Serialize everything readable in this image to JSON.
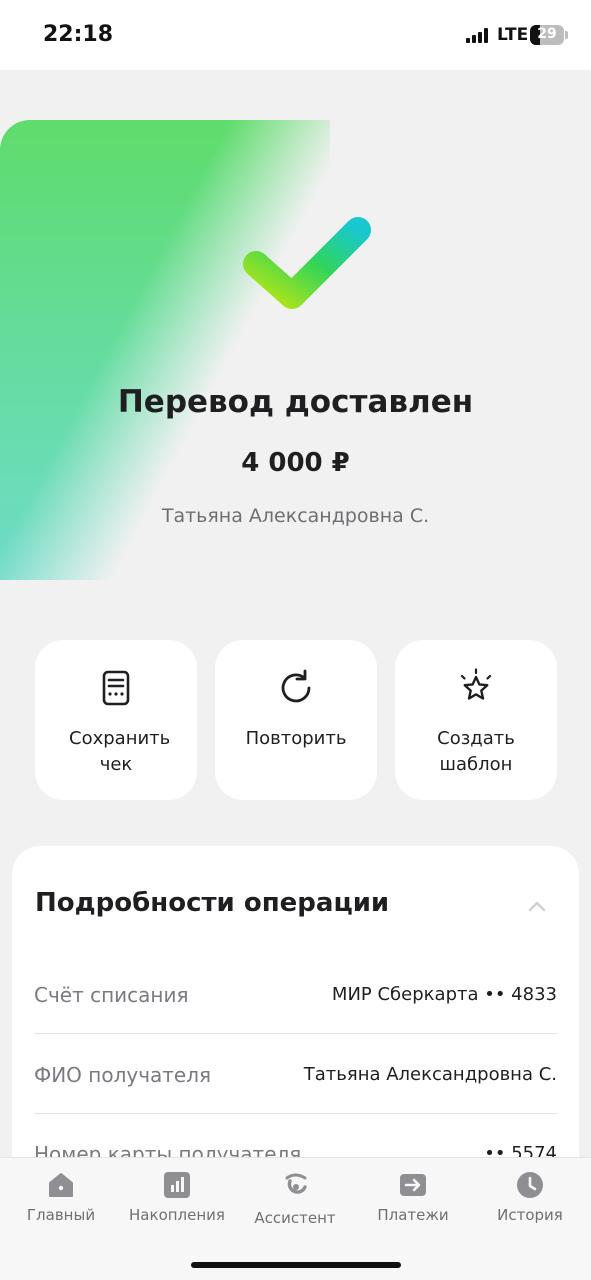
{
  "status": {
    "time": "22:18",
    "network": "LTE",
    "battery": "29",
    "battery_level": 0.29
  },
  "result": {
    "title": "Перевод доставлен",
    "amount": "4 000 ₽",
    "recipient": "Татьяна Александровна С.",
    "icon": "checkmark-icon"
  },
  "actions": [
    {
      "icon": "receipt-icon",
      "label": "Сохранить чек"
    },
    {
      "icon": "repeat-icon",
      "label": "Повторить"
    },
    {
      "icon": "star-icon",
      "label": "Создать шаблон"
    }
  ],
  "details": {
    "title": "Подробности операции",
    "rows": [
      {
        "label": "Счёт списания",
        "value": "МИР Сберкарта •• 4833"
      },
      {
        "label": "ФИО получателя",
        "value": "Татьяна Александровна С."
      },
      {
        "label": "Номер карты получателя",
        "value": "•• 5574"
      }
    ]
  },
  "nav": [
    {
      "icon": "home-icon",
      "label": "Главный"
    },
    {
      "icon": "chart-icon",
      "label": "Накопления"
    },
    {
      "icon": "assistant-icon",
      "label": "Ассистент"
    },
    {
      "icon": "transfer-icon",
      "label": "Платежи"
    },
    {
      "icon": "clock-icon",
      "label": "История"
    }
  ],
  "colors": {
    "accent_green": "#21a038",
    "check_start": "#b8e614",
    "check_end": "#19c8cf"
  }
}
